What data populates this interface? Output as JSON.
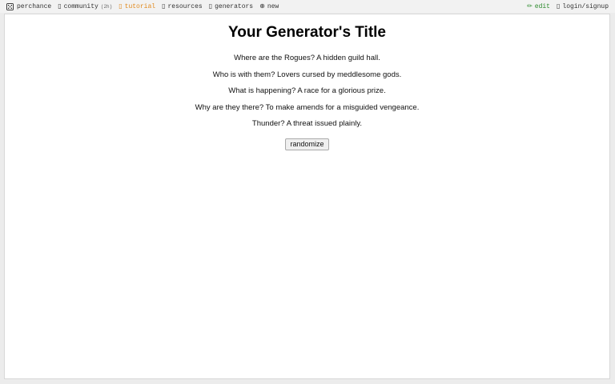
{
  "topbar": {
    "left": [
      {
        "label": "perchance",
        "icon": "die-icon"
      },
      {
        "label": "community",
        "badge": "(2h)",
        "icon": "chat-icon"
      },
      {
        "label": "tutorial",
        "icon": "book-icon",
        "color": "#e08a1e"
      },
      {
        "label": "resources",
        "icon": "resources-icon"
      },
      {
        "label": "generators",
        "icon": "list-icon"
      },
      {
        "label": "new",
        "icon": "plus-circle-icon"
      }
    ],
    "right": [
      {
        "label": "edit",
        "icon": "pencil-icon",
        "color": "#2e8b2e"
      },
      {
        "label": "login/signup",
        "icon": "user-icon"
      }
    ]
  },
  "main": {
    "title": "Your Generator's Title",
    "lines": [
      "Where are the Rogues? A hidden guild hall.",
      "Who is with them? Lovers cursed by meddlesome gods.",
      "What is happening? A race for a glorious prize.",
      "Why are they there? To make amends for a misguided vengeance.",
      "Thunder? A threat issued plainly."
    ],
    "button_label": "randomize"
  }
}
